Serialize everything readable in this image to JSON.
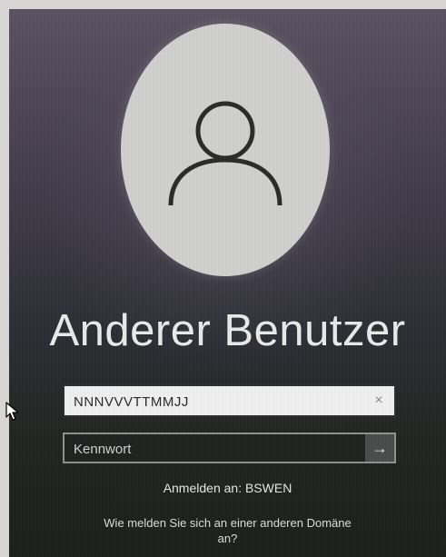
{
  "login": {
    "display_name": "Anderer Benutzer",
    "username_value": "NNNVVVTTMMJJ",
    "password_placeholder": "Kennwort",
    "sign_in_to": "Anmelden an: BSWEN",
    "other_domain_link": "Wie melden Sie sich an einer anderen Domäne an?",
    "clear_glyph": "×",
    "submit_glyph": "→"
  },
  "icons": {
    "avatar": "user-silhouette-icon",
    "clear": "close-icon",
    "submit": "arrow-right-icon",
    "cursor": "mouse-pointer-icon"
  },
  "colors": {
    "avatar_circle": "#cfcfce",
    "field_light": "#efefef",
    "field_dark": "#202221",
    "text_light": "#e9e9ea"
  }
}
